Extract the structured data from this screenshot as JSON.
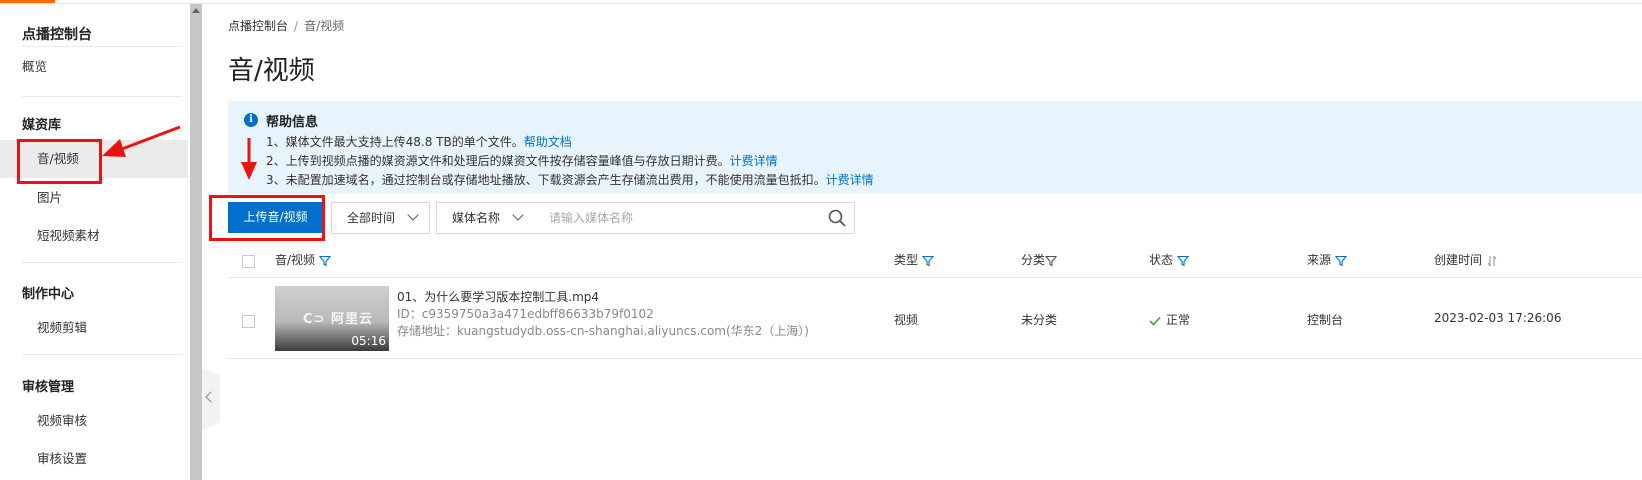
{
  "sidebar": {
    "title": "点播控制台",
    "overview": "概览",
    "groups": [
      {
        "title": "媒资库"
      },
      {
        "title": "制作中心"
      },
      {
        "title": "审核管理"
      }
    ],
    "items": {
      "audio_video": "音/视频",
      "image": "图片",
      "short_video_material": "短视频素材",
      "video_editing": "视频剪辑",
      "video_review": "视频审核",
      "review_settings": "审核设置"
    }
  },
  "breadcrumb": {
    "root": "点播控制台",
    "separator": "/",
    "current": "音/视频"
  },
  "page_title": "音/视频",
  "help": {
    "title": "帮助信息",
    "line1": "1、媒体文件最大支持上传48.8 TB的单个文件。",
    "line1_link": "帮助文档",
    "line2": "2、上传到视频点播的媒资源文件和处理后的媒资文件按存储容量峰值与存放日期计费。",
    "line2_link": "计费详情",
    "line3": "3、未配置加速域名，通过控制台或存储地址播放、下载资源会产生存储流出费用，不能使用流量包抵扣。",
    "line3_link": "计费详情"
  },
  "toolbar": {
    "upload_label": "上传音/视频",
    "time_filter": "全部时间",
    "search_field": "媒体名称",
    "search_placeholder": "请输入媒体名称"
  },
  "table": {
    "headers": {
      "media": "音/视频",
      "type": "类型",
      "category": "分类",
      "status": "状态",
      "source": "来源",
      "created": "创建时间"
    },
    "rows": [
      {
        "duration": "05:16",
        "thumb_logo": "C⊃ 阿里云",
        "name": "01、为什么要学习版本控制工具.mp4",
        "id": "ID：c9359750a3a471edbff86633b79f0102",
        "storage": "存储地址：kuangstudydb.oss-cn-shanghai.aliyuncs.com(华东2（上海）)",
        "type": "视频",
        "category": "未分类",
        "status": "正常",
        "source": "控制台",
        "created": "2023-02-03 17:26:06"
      }
    ]
  },
  "colors": {
    "primary": "#0070cc",
    "annotation": "#ee1111",
    "status_ok": "#2aa845"
  },
  "icons": [
    "info-icon",
    "search-icon",
    "filter-icon",
    "sort-icon",
    "check-icon",
    "chevron-down-icon",
    "chevron-left-icon"
  ]
}
